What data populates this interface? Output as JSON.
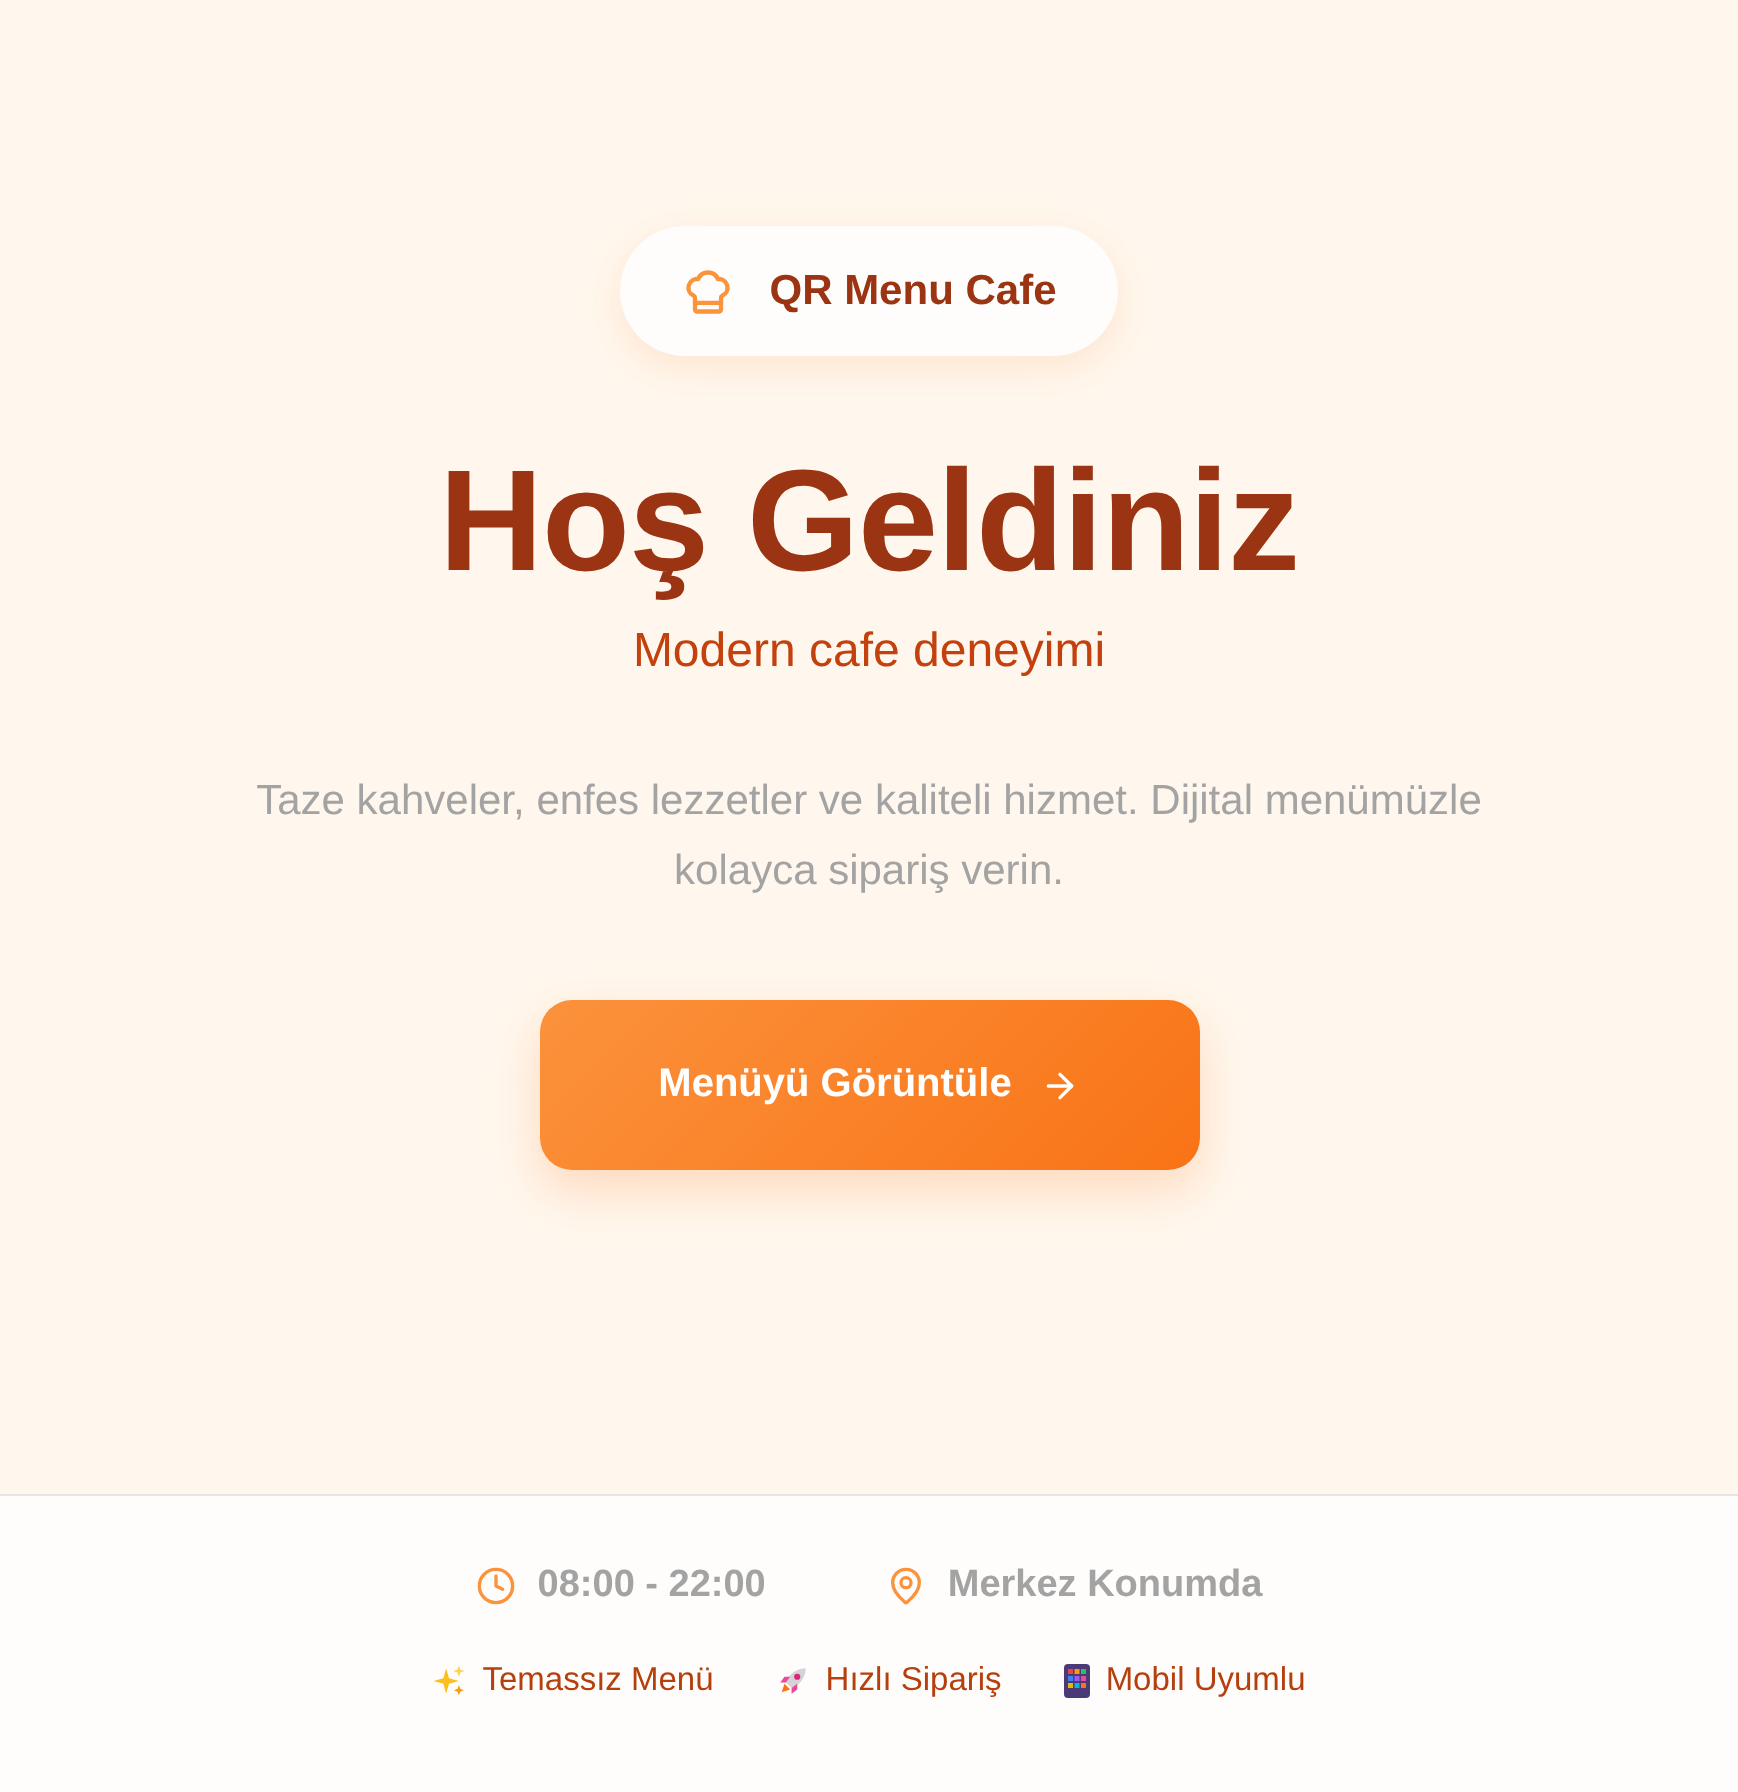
{
  "brand": {
    "name": "QR Menu Cafe"
  },
  "hero": {
    "title": "Hoş Geldiniz",
    "subtitle": "Modern cafe deneyimi",
    "description": "Taze kahveler, enfes lezzetler ve kaliteli hizmet. Dijital menümüzle kolayca sipariş verin.",
    "cta": "Menüyü Görüntüle"
  },
  "info": [
    {
      "kind": "hours",
      "text": "08:00 - 22:00"
    },
    {
      "kind": "location",
      "text": "Merkez Konumda"
    }
  ],
  "features": [
    {
      "kind": "sparkles",
      "label": "Temassız Menü"
    },
    {
      "kind": "rocket",
      "label": "Hızlı Sipariş"
    },
    {
      "kind": "phone",
      "label": "Mobil Uyumlu"
    }
  ]
}
